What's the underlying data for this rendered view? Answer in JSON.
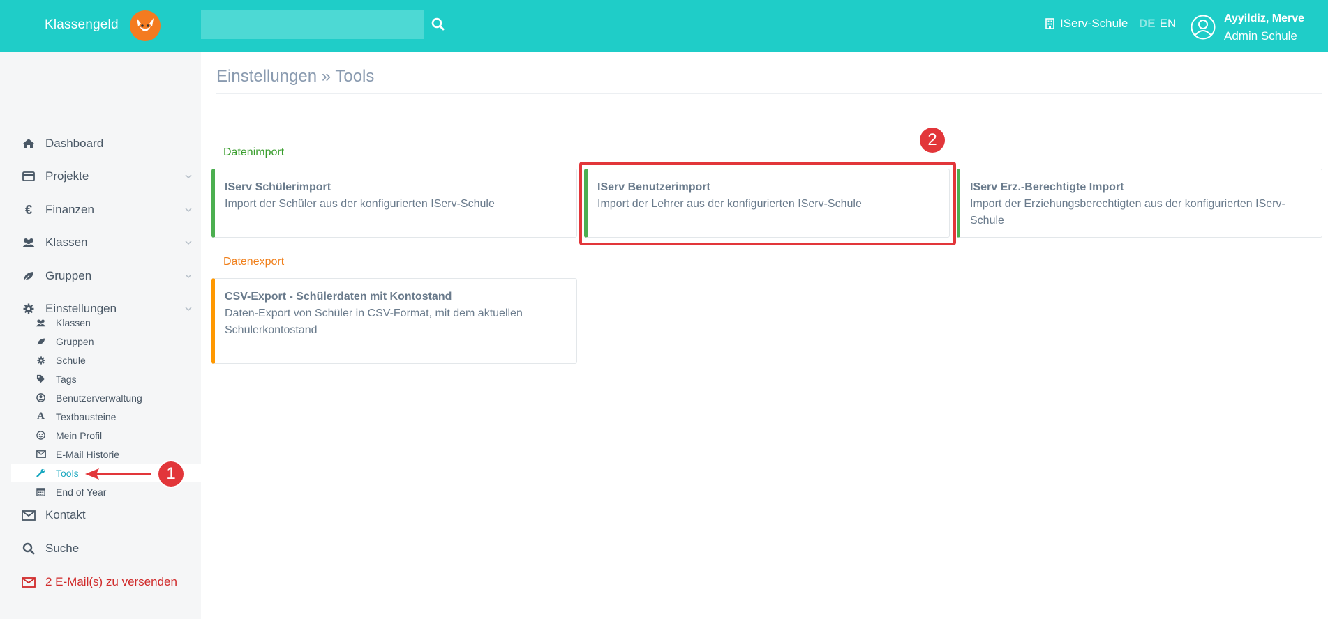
{
  "header": {
    "logo_text": "Klassengeld",
    "search_placeholder": "",
    "school": "IServ-Schule",
    "lang_de": "DE",
    "lang_en": "EN",
    "user_name": "Ayyildiz, Merve",
    "user_role": "Admin Schule",
    "accent_color": "#1fcdc8"
  },
  "sidebar": {
    "items": [
      {
        "label": "Dashboard",
        "icon": "home-icon"
      },
      {
        "label": "Projekte",
        "icon": "card-icon"
      },
      {
        "label": "Finanzen",
        "icon": "euro-icon"
      },
      {
        "label": "Klassen",
        "icon": "users-icon"
      },
      {
        "label": "Gruppen",
        "icon": "leaf-icon"
      },
      {
        "label": "Einstellungen",
        "icon": "gear-icon"
      }
    ],
    "sub_items": [
      {
        "label": "Klassen",
        "icon": "users-icon"
      },
      {
        "label": "Gruppen",
        "icon": "leaf-icon"
      },
      {
        "label": "Schule",
        "icon": "gear-icon"
      },
      {
        "label": "Tags",
        "icon": "tag-icon"
      },
      {
        "label": "Benutzerverwaltung",
        "icon": "user-circle-icon"
      },
      {
        "label": "Textbausteine",
        "icon": "font-icon"
      },
      {
        "label": "Mein Profil",
        "icon": "smile-icon"
      },
      {
        "label": "E-Mail Historie",
        "icon": "envelope-icon"
      },
      {
        "label": "Tools",
        "icon": "wrench-icon"
      },
      {
        "label": "End of Year",
        "icon": "calendar-icon"
      }
    ],
    "bottom_items": [
      {
        "label": "Kontakt",
        "icon": "envelope-icon"
      },
      {
        "label": "Suche",
        "icon": "search-icon"
      },
      {
        "label": "2 E-Mail(s) zu versenden",
        "icon": "envelope-icon"
      }
    ]
  },
  "main": {
    "breadcrumb": "Einstellungen » Tools",
    "import_section": "Datenimport",
    "export_section": "Datenexport",
    "import_cards": [
      {
        "title": "IServ Schülerimport",
        "desc": "Import der Schüler aus der konfigurierten IServ-Schule"
      },
      {
        "title": "IServ Benutzerimport",
        "desc": "Import der Lehrer aus der konfigurierten IServ-Schule"
      },
      {
        "title": "IServ Erz.-Berechtigte Import",
        "desc": "Import der Erziehungsberechtigten aus der konfigurierten IServ-Schule"
      }
    ],
    "export_cards": [
      {
        "title": "CSV-Export - Schülerdaten mit Kontostand",
        "desc": "Daten-Export von Schüler in CSV-Format, mit dem aktuellen Schülerkontostand"
      }
    ]
  },
  "annotations": {
    "badge_1": "1",
    "badge_2": "2"
  }
}
